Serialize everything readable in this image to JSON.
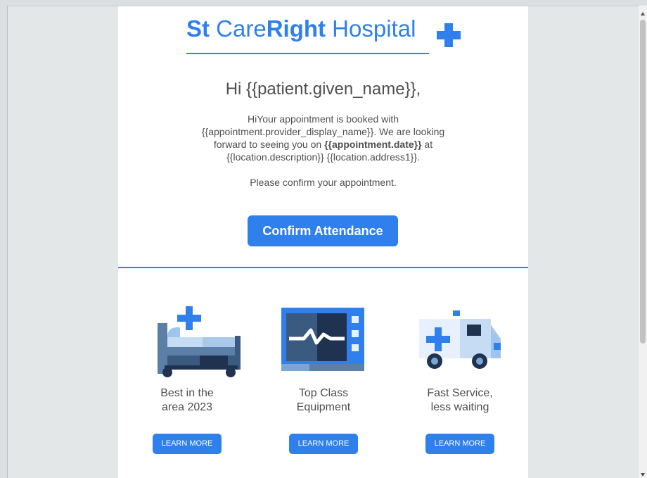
{
  "brand": {
    "part1": "St ",
    "part2": "Care",
    "part3": "Right",
    "part4": " Hospital"
  },
  "email": {
    "greeting": "Hi {{patient.given_name}},",
    "body_line1": "HiYour appointment is booked with",
    "body_line2": "{{appointment.provider_display_name}}. We are looking",
    "body_line3_pre": "forward to seeing you on ",
    "body_line3_bold": "{{appointment.date}}",
    "body_line3_post": " at",
    "body_line4": "{{location.description}} {{location.address1}}.",
    "confirm_prompt": "Please confirm your appointment.",
    "confirm_button": "Confirm Attendance"
  },
  "features": [
    {
      "line1": "Best in the",
      "line2": "area 2023",
      "button": "LEARN MORE",
      "icon": "hospital-bed-icon"
    },
    {
      "line1": "Top Class",
      "line2": "Equipment",
      "button": "LEARN MORE",
      "icon": "heart-monitor-icon"
    },
    {
      "line1": "Fast Service,",
      "line2": "less waiting",
      "button": "LEARN MORE",
      "icon": "ambulance-icon"
    }
  ],
  "colors": {
    "accent": "#2f80ed",
    "text": "#4f4f4f",
    "page_background": "#dcdfe1"
  }
}
